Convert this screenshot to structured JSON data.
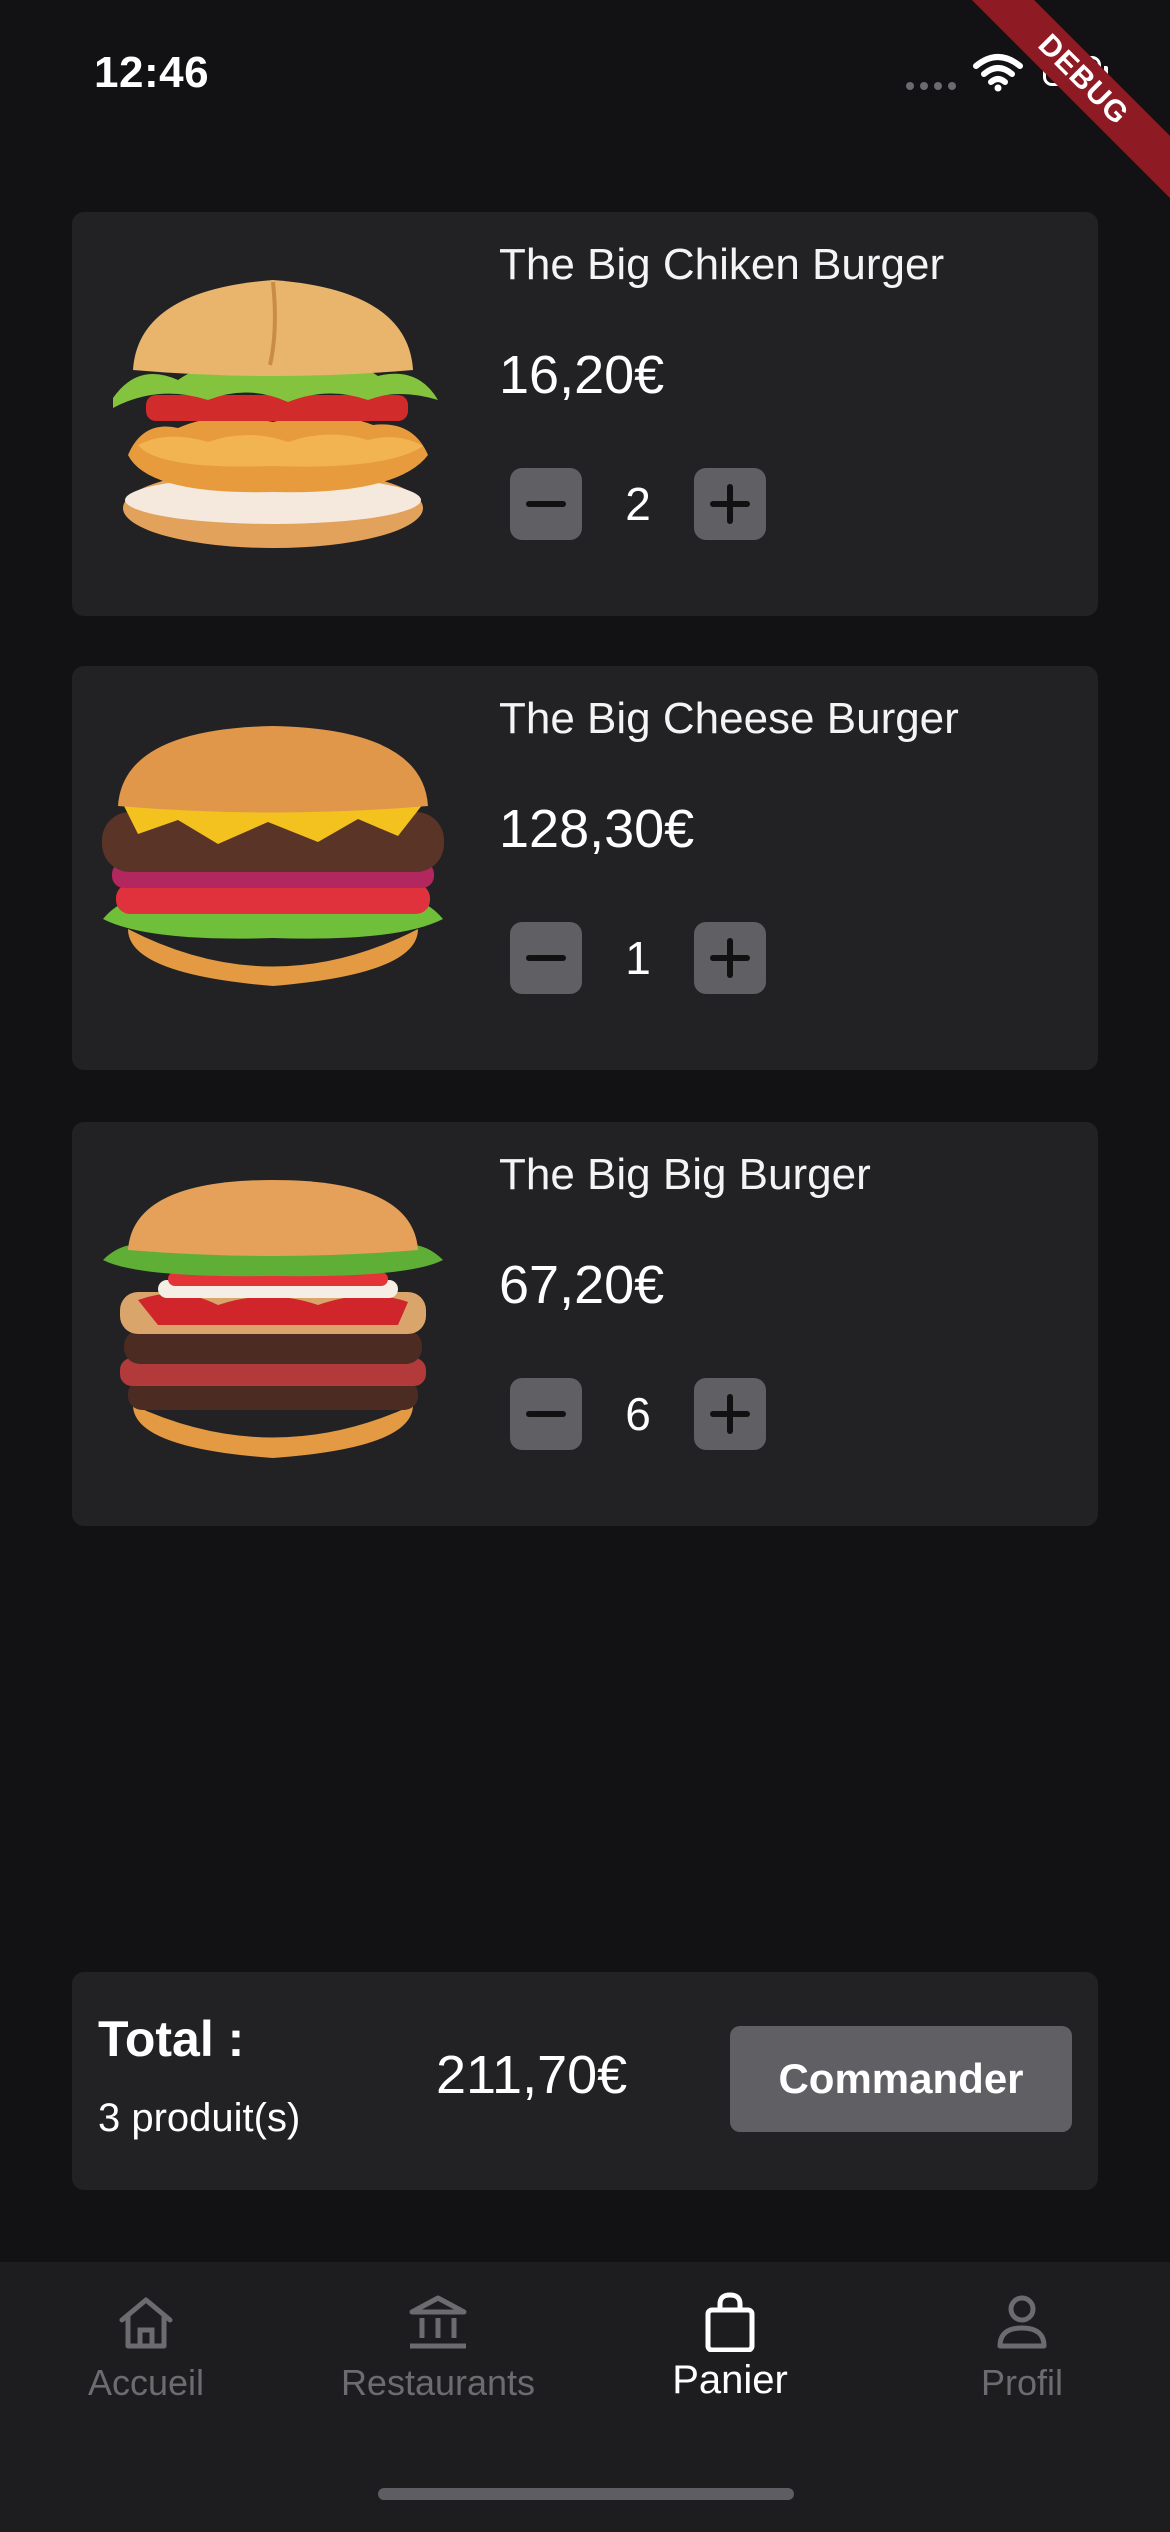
{
  "status_bar": {
    "time": "12:46",
    "debug_label": "DEBUG"
  },
  "cart": {
    "items": [
      {
        "name": "The Big Chiken Burger",
        "price": "16,20€",
        "quantity": "2",
        "image": "chicken-burger"
      },
      {
        "name": "The Big Cheese Burger",
        "price": "128,30€",
        "quantity": "1",
        "image": "cheese-burger"
      },
      {
        "name": "The Big Big Burger",
        "price": "67,20€",
        "quantity": "6",
        "image": "big-burger"
      }
    ],
    "decrement_icon": "minus-icon",
    "increment_icon": "plus-icon"
  },
  "summary": {
    "label": "Total :",
    "count": "3 produit(s)",
    "amount": "211,70€",
    "button_label": "Commander"
  },
  "nav": {
    "items": [
      {
        "label": "Accueil",
        "icon": "home-icon",
        "active": false
      },
      {
        "label": "Restaurants",
        "icon": "bank-icon",
        "active": false
      },
      {
        "label": "Panier",
        "icon": "shopping-bag-icon",
        "active": true
      },
      {
        "label": "Profil",
        "icon": "person-icon",
        "active": false
      }
    ]
  },
  "colors": {
    "background": "#121114",
    "card": "#222224",
    "button": "#5f5f64",
    "nav_background": "#1d1d1f",
    "nav_inactive": "#6c6c70",
    "nav_active": "#ffffff",
    "debug_banner": "#8e1b23"
  }
}
